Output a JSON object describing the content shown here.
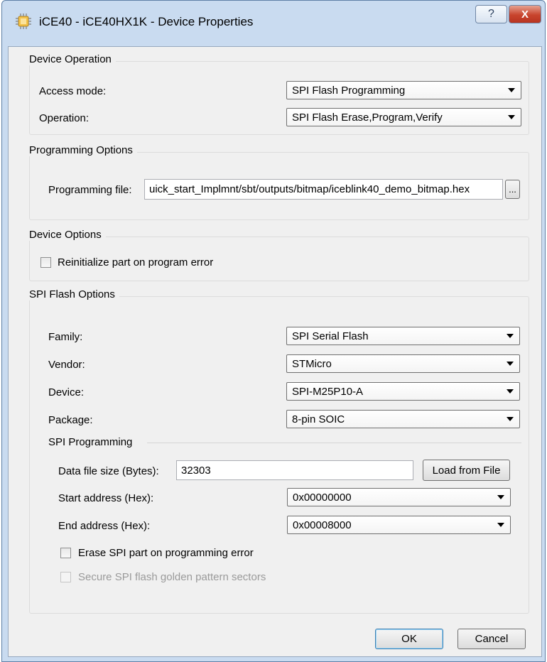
{
  "window": {
    "title": "iCE40 - iCE40HX1K - Device Properties",
    "help_glyph": "?",
    "close_glyph": "X"
  },
  "device_operation": {
    "title": "Device Operation",
    "access_mode_label": "Access mode:",
    "access_mode_value": "SPI Flash Programming",
    "operation_label": "Operation:",
    "operation_value": "SPI Flash Erase,Program,Verify"
  },
  "programming_options": {
    "title": "Programming Options",
    "file_label": "Programming file:",
    "file_value": "uick_start_Implmnt/sbt/outputs/bitmap/iceblink40_demo_bitmap.hex",
    "browse_label": "..."
  },
  "device_options": {
    "title": "Device Options",
    "reinitialize_label": "Reinitialize part on program error",
    "reinitialize_checked": false
  },
  "spi_flash_options": {
    "title": "SPI Flash Options",
    "family_label": "Family:",
    "family_value": "SPI Serial Flash",
    "vendor_label": "Vendor:",
    "vendor_value": "STMicro",
    "device_label": "Device:",
    "device_value": "SPI-M25P10-A",
    "package_label": "Package:",
    "package_value": "8-pin SOIC"
  },
  "spi_programming": {
    "title": "SPI Programming",
    "data_size_label": "Data file size (Bytes):",
    "data_size_value": "32303",
    "load_button": "Load from File",
    "start_label": "Start address (Hex):",
    "start_value": "0x00000000",
    "end_label": "End address (Hex):",
    "end_value": "0x00008000",
    "erase_label": "Erase SPI part on programming error",
    "erase_checked": false,
    "secure_label": "Secure SPI flash golden pattern sectors",
    "secure_enabled": false
  },
  "buttons": {
    "ok": "OK",
    "cancel": "Cancel"
  },
  "colors": {
    "title_bar": "#c9dbf0",
    "close_button": "#c8442d",
    "dialog_bg": "#f0f0f0"
  }
}
